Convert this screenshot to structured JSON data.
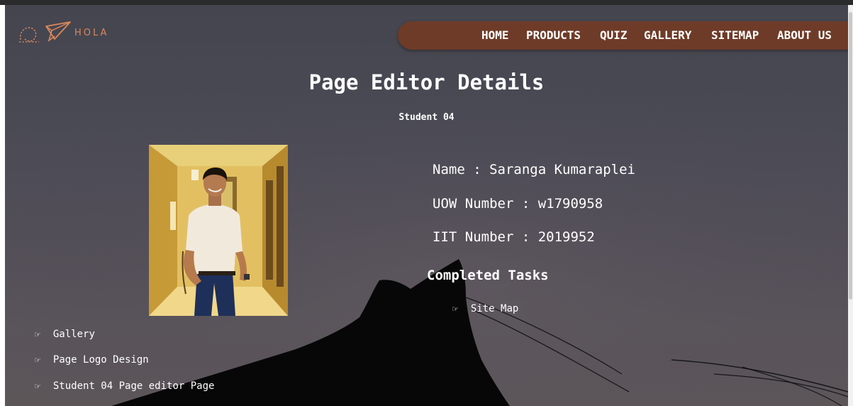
{
  "logo": {
    "text": "HOLA",
    "icon": "paper-plane-icon",
    "color": "#d9885a"
  },
  "nav": {
    "background": "#6e3b28",
    "items": [
      {
        "label": "HOME"
      },
      {
        "label": "PRODUCTS"
      },
      {
        "label": "QUIZ"
      },
      {
        "label": "GALLERY"
      },
      {
        "label": "SITEMAP"
      },
      {
        "label": "ABOUT US"
      }
    ]
  },
  "page": {
    "title": "Page Editor Details",
    "subtitle": "Student 04"
  },
  "profile": {
    "name_line": "Name : Saranga Kumaraplei",
    "uow_line": "UOW Number : w1790958",
    "iit_line": "IIT Number : 2019952"
  },
  "tasks": {
    "heading": "Completed Tasks",
    "bullet_icon": "pointing-hand-icon",
    "bullet_glyph": "☞",
    "items": [
      {
        "label": "Site Map"
      },
      {
        "label": "Gallery"
      },
      {
        "label": "Page Logo Design"
      },
      {
        "label": "Student 04 Page editor Page"
      }
    ]
  }
}
